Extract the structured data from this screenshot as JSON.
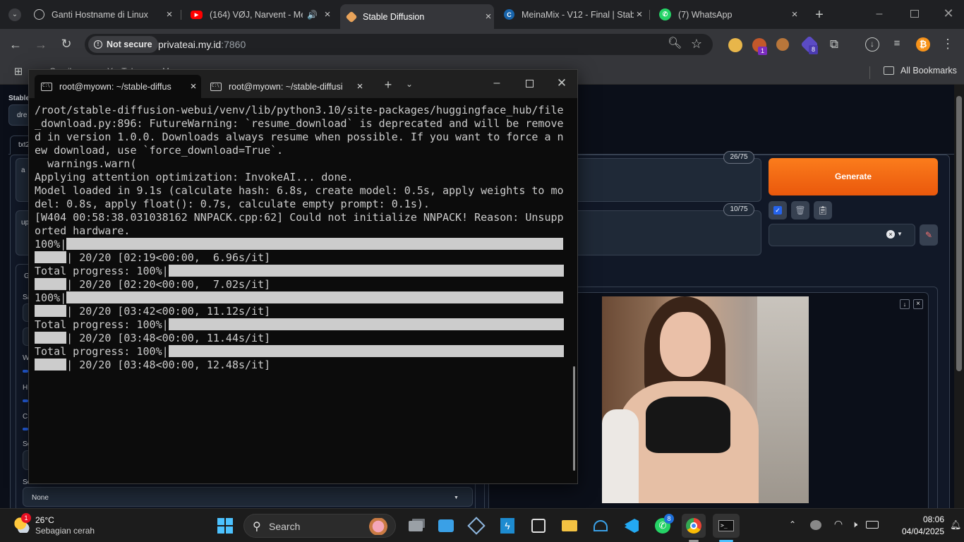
{
  "browser": {
    "tabs": [
      {
        "title": "Ganti Hostname di Linux",
        "favicon": "globe-icon"
      },
      {
        "title": "(164) VØJ, Narvent - Mer",
        "favicon": "youtube-icon"
      },
      {
        "title": "Stable Diffusion",
        "favicon": "sd-icon",
        "active": true
      },
      {
        "title": "MeinaMix - V12 - Final | Stab",
        "favicon": "civitai-icon"
      },
      {
        "title": "(7) WhatsApp",
        "favicon": "whatsapp-icon"
      }
    ],
    "security_label": "Not secure",
    "url_host": "privateai.my.id",
    "url_port": ":7860",
    "bookmarks": [
      "Gmail",
      "YouTube",
      "Maps"
    ],
    "all_bookmarks": "All Bookmarks",
    "extension_badges": [
      "1",
      "8"
    ]
  },
  "sd": {
    "title_partial": "Stable",
    "model_partial": "dre",
    "tab_partial": "txt2",
    "prompt_counter": "26/75",
    "negative_counter": "10/75",
    "generate_label": "Generate",
    "left_labels": [
      "a",
      "up",
      "G",
      "Sa",
      "W",
      "H",
      "C",
      "Se",
      "Sc"
    ],
    "script_value": "None",
    "colors": {
      "generate": "#f97316",
      "accent": "#2563eb"
    }
  },
  "terminal": {
    "tabs": [
      {
        "title": "root@myown: ~/stable-diffus"
      },
      {
        "title": "root@myown: ~/stable-diffusi"
      }
    ],
    "lines": [
      "/root/stable-diffusion-webui/venv/lib/python3.10/site-packages/huggingface_hub/file",
      "_download.py:896: FutureWarning: `resume_download` is deprecated and will be remove",
      "d in version 1.0.0. Downloads always resume when possible. If you want to force a n",
      "ew download, use `force_download=True`.",
      "  warnings.warn(",
      "Applying attention optimization: InvokeAI... done.",
      "Model loaded in 9.1s (calculate hash: 6.8s, create model: 0.5s, apply weights to mo",
      "del: 0.8s, apply float(): 0.7s, calculate empty prompt: 0.1s).",
      "[W404 00:58:38.031038162 NNPACK.cpp:62] Could not initialize NNPACK! Reason: Unsupp",
      "orted hardware."
    ],
    "progress": [
      {
        "prefix": "100%|",
        "stats": "| 20/20 [02:19<00:00,  6.96s/it]",
        "fill": 1.0
      },
      {
        "prefix": "Total progress: 100%|",
        "stats": "| 20/20 [02:20<00:00,  7.02s/it]",
        "fill": 1.0
      },
      {
        "prefix": "100%|",
        "stats": "| 20/20 [03:42<00:00, 11.12s/it]",
        "fill": 1.0
      },
      {
        "prefix": "Total progress: 100%|",
        "stats": "| 20/20 [03:48<00:00, 11.44s/it]",
        "fill": 1.0
      },
      {
        "prefix": "Total progress: 100%|",
        "stats": "| 20/20 [03:48<00:00, 12.48s/it]",
        "fill": 1.0
      }
    ]
  },
  "taskbar": {
    "weather_temp": "26°C",
    "weather_desc": "Sebagian cerah",
    "weather_badge": "1",
    "search_label": "Search",
    "whatsapp_badge": "8",
    "time": "08:06",
    "date": "04/04/2025"
  }
}
